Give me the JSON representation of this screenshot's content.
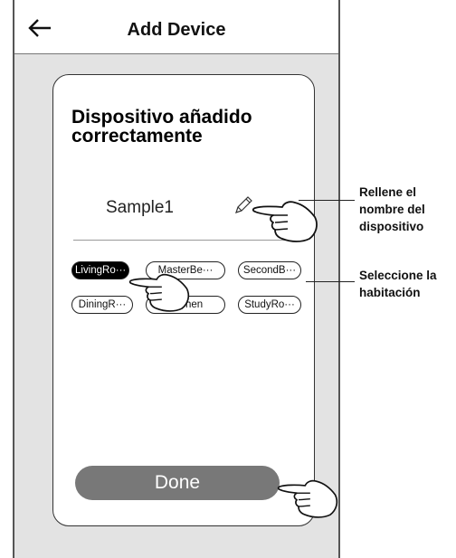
{
  "header": {
    "title": "Add Device",
    "back_icon": "arrow-left-icon"
  },
  "card": {
    "title": "Dispositivo añadido correctamente",
    "device_name": "Sample1",
    "edit_icon": "pencil-icon",
    "rooms": [
      {
        "label": "LivingRo···",
        "selected": true
      },
      {
        "label": "MasterBe···",
        "selected": false
      },
      {
        "label": "SecondB···",
        "selected": false
      },
      {
        "label": "DiningR···",
        "selected": false
      },
      {
        "label": "Kitchen",
        "selected": false
      },
      {
        "label": "StudyRo···",
        "selected": false
      }
    ],
    "done_label": "Done"
  },
  "annotations": {
    "name_hint": "Rellene el\nnombre del\ndispositivo",
    "room_hint": "Seleccione la\nhabitación"
  },
  "colors": {
    "frame_background": "#e3e3e3",
    "done_button": "#787878",
    "selected_chip": "#000000"
  }
}
